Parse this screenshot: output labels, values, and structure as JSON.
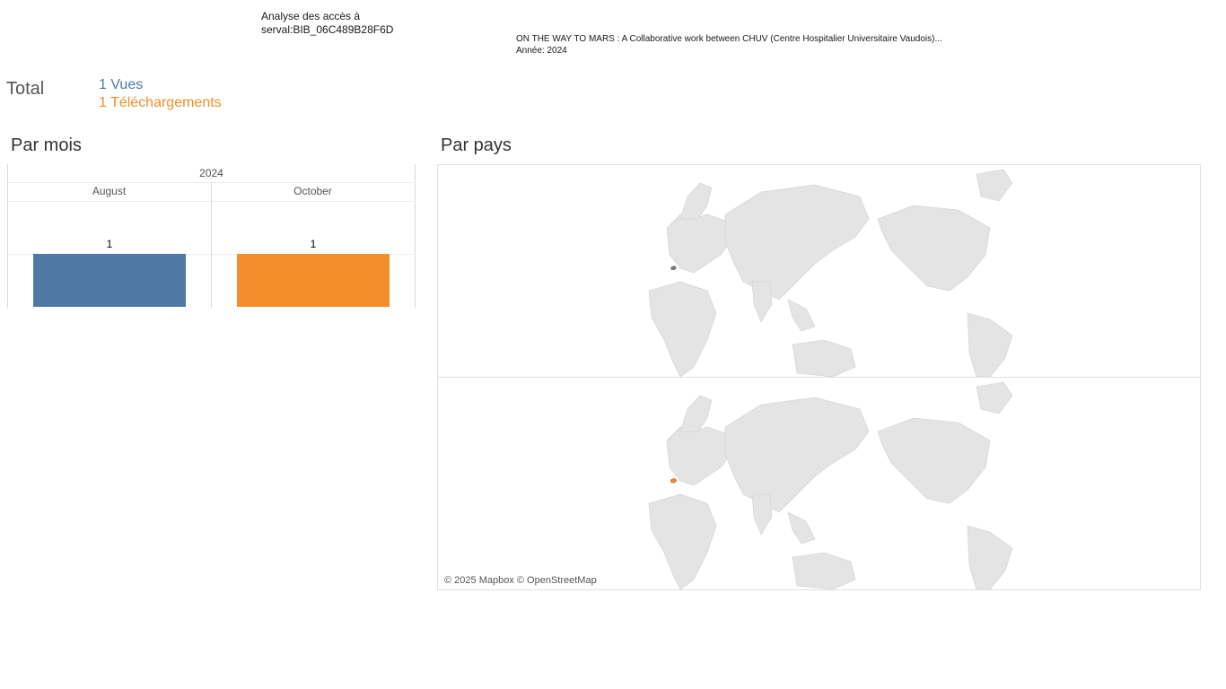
{
  "header": {
    "title_line1": "Analyse des accès à",
    "title_line2": " serval:BIB_06C489B28F6D",
    "doc_title": "ON THE WAY TO MARS : A Collaborative work between CHUV (Centre Hospitalier Universitaire Vaudois)...",
    "year_label": "Année: 2024"
  },
  "totals": {
    "label": "Total",
    "views": "1 Vues",
    "downloads": "1 Téléchargements"
  },
  "colors": {
    "views": "#4e79a7",
    "downloads": "#f28e2b",
    "land": "#e4e4e4",
    "highlight": "#7a7a7a"
  },
  "monthly": {
    "title": "Par mois",
    "year": "2024",
    "months": [
      {
        "label": "August",
        "value": "1",
        "series": "views"
      },
      {
        "label": "October",
        "value": "1",
        "series": "downloads"
      }
    ]
  },
  "countries": {
    "title": "Par pays",
    "attribution": "© 2025 Mapbox © OpenStreetMap",
    "maps": [
      {
        "series": "views",
        "highlighted_country": "Switzerland"
      },
      {
        "series": "downloads",
        "highlighted_country": "Switzerland"
      }
    ]
  }
}
